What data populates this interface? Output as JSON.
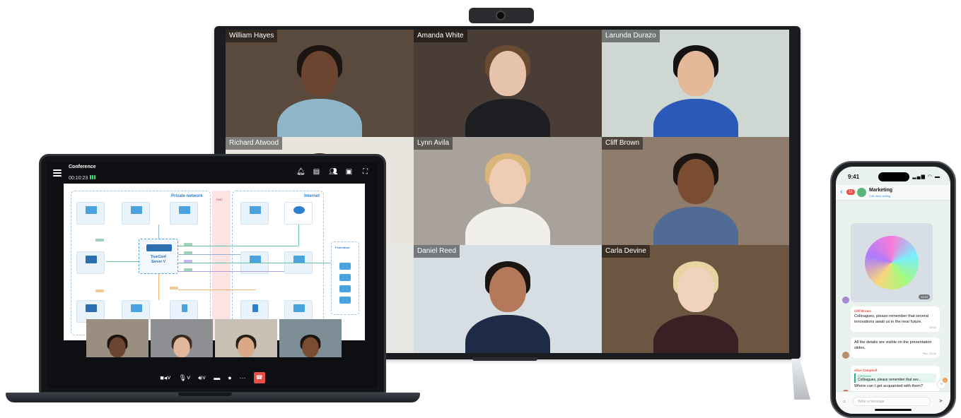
{
  "tv": {
    "participants": [
      {
        "name": "William Hayes",
        "bg": "#5a4a3e",
        "skin": "#6b4530",
        "hair": "#1c1410",
        "shirt": "#8fb5c8"
      },
      {
        "name": "Amanda White",
        "bg": "#4a3d35",
        "skin": "#e6c3ab",
        "hair": "#6a4a30",
        "shirt": "#1d1e22"
      },
      {
        "name": "Larunda Durazo",
        "bg": "#cfd7d3",
        "skin": "#e3b999",
        "hair": "#141312",
        "shirt": "#2b59b8"
      },
      {
        "name": "Richard Atwood",
        "bg": "#e8e4de",
        "skin": "#e6c3ab",
        "hair": "#3b2a20",
        "shirt": "#6f7c86"
      },
      {
        "name": "Lynn Avila",
        "bg": "#a9a29a",
        "skin": "#efcdb4",
        "hair": "#d9b57a",
        "shirt": "#f1efec"
      },
      {
        "name": "Cliff Brown",
        "bg": "#8e7d6c",
        "skin": "#7a4d33",
        "hair": "#1c1410",
        "shirt": "#4f6b93"
      },
      {
        "name": "",
        "bg": "#e6e6e3",
        "skin": "#e6c3ab",
        "hair": "#3b2a20",
        "shirt": "#c9c9c4"
      },
      {
        "name": "Daniel Reed",
        "bg": "#d6dde3",
        "skin": "#b4795a",
        "hair": "#1c1410",
        "shirt": "#1e2b47"
      },
      {
        "name": "Carla Devine",
        "bg": "#6c5641",
        "skin": "#f0d2bd",
        "hair": "#e9d3a3",
        "shirt": "#3a1f25"
      }
    ]
  },
  "laptop": {
    "conference_title": "Conference",
    "timer": "00:10:23",
    "top_icons": [
      "bell-icon",
      "chat-icon",
      "participants-icon",
      "content-share-icon",
      "fullscreen-icon"
    ],
    "diagram": {
      "private_network_label": "Private network",
      "internet_label": "Internet",
      "dmz_label": "DMZ",
      "server_name_line1": "TrueConf",
      "server_name_line2": "Server V",
      "federation_label": "Federation"
    },
    "thumbnails": [
      {
        "skin": "#6b4530",
        "hair": "#1c1410",
        "shirt": "#374656",
        "bg": "#9a8e80"
      },
      {
        "skin": "#e0b79a",
        "hair": "#3b2a20",
        "shirt": "#3b5b8f",
        "bg": "#8e8f92"
      },
      {
        "skin": "#d9a987",
        "hair": "#2a1d14",
        "shirt": "#d6c3aa",
        "bg": "#c8bfb5"
      },
      {
        "skin": "#7a4d33",
        "hair": "#1c1410",
        "shirt": "#272727",
        "bg": "#7d8e96"
      }
    ],
    "controls": [
      "camera-icon",
      "microphone-icon",
      "speaker-icon",
      "screen-share-icon",
      "raise-hand-icon",
      "more-icon",
      "hangup-icon"
    ]
  },
  "phone": {
    "time": "9:41",
    "status": "▂▄▆ ◠ ▬",
    "back_badge": "16",
    "chat_name": "Marketing",
    "chat_subtitle": "Cliff, Alice writing",
    "media_time": "11:42",
    "messages": [
      {
        "author": "Cliff Brown",
        "text": "Colleagues, please remember that several innovations await us in the near future.",
        "time": "12:02"
      },
      {
        "text": "All the details are visible on the presentation slides.",
        "time": "Рер. 12:04"
      },
      {
        "author": "Alice Campbell",
        "reply_author": "Cliff Brown",
        "reply_text": "Colleagues, please remember that sev...",
        "text": "Where can I get acquainted with them?"
      }
    ],
    "compose_placeholder": "Write a message",
    "unread_count": "1"
  }
}
